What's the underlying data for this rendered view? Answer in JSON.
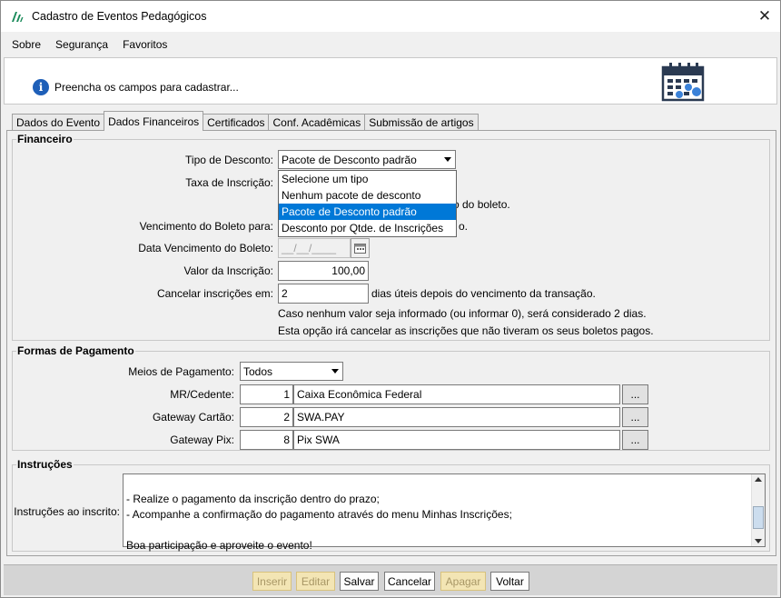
{
  "window": {
    "title": "Cadastro de Eventos Pedagógicos",
    "close": "✕"
  },
  "menu": {
    "items": [
      "Sobre",
      "Segurança",
      "Favoritos"
    ]
  },
  "info": {
    "text": "Preencha os campos para cadastrar..."
  },
  "tabs": [
    "Dados do Evento",
    "Dados Financeiros",
    "Certificados",
    "Conf. Acadêmicas",
    "Submissão de artigos"
  ],
  "active_tab": "Dados Financeiros",
  "financeiro": {
    "title": "Financeiro",
    "tipo_desconto_label": "Tipo de Desconto:",
    "tipo_desconto_value": "Pacote de Desconto padrão",
    "dropdown_options": [
      "Selecione um tipo",
      "Nenhum pacote de desconto",
      "Pacote de Desconto padrão",
      "Desconto por Qtde. de Inscrições"
    ],
    "dropdown_selected_index": 2,
    "taxa_label": "Taxa de Inscrição:",
    "taxa_partial_text": "o do boleto.",
    "vencimento_label": "Vencimento do Boleto para:",
    "vencimento_partial_text": "o.",
    "data_venc_label": "Data Vencimento do Boleto:",
    "data_venc_placeholder": "__/__/____",
    "valor_label": "Valor da Inscrição:",
    "valor_value": "100,00",
    "cancelar_label": "Cancelar inscrições em:",
    "cancelar_value": "2",
    "cancelar_suffix": "dias úteis depois do vencimento da transação.",
    "note1": "Caso nenhum valor seja informado (ou informar 0), será considerado 2 dias.",
    "note2": "Esta opção irá cancelar as inscrições que não tiveram os seus boletos pagos."
  },
  "pagamento": {
    "title": "Formas de Pagamento",
    "meios_label": "Meios de Pagamento:",
    "meios_value": "Todos",
    "rows": [
      {
        "label": "MR/Cedente:",
        "code": "1",
        "name": "Caixa Econômica Federal"
      },
      {
        "label": "Gateway Cartão:",
        "code": "2",
        "name": "SWA.PAY"
      },
      {
        "label": "Gateway Pix:",
        "code": "8",
        "name": "Pix SWA"
      }
    ],
    "ellipsis": "..."
  },
  "instrucoes": {
    "title": "Instruções",
    "label": "Instruções ao inscrito:",
    "lines": [
      "",
      "- Realize o pagamento da inscrição dentro do prazo;",
      "- Acompanhe a confirmação do pagamento através do menu Minhas Inscrições;",
      "",
      "Boa participação e aproveite o evento!"
    ]
  },
  "buttons": {
    "inserir": "Inserir",
    "editar": "Editar",
    "salvar": "Salvar",
    "cancelar": "Cancelar",
    "apagar": "Apagar",
    "voltar": "Voltar"
  },
  "colors": {
    "selection": "#0078d7",
    "disabled_button": "#f3e5b4",
    "info_icon": "#1e5fb8"
  },
  "icons": {
    "app": "app-logo-icon",
    "info": "info-icon",
    "calendar": "calendar-icon",
    "close": "close-icon"
  }
}
